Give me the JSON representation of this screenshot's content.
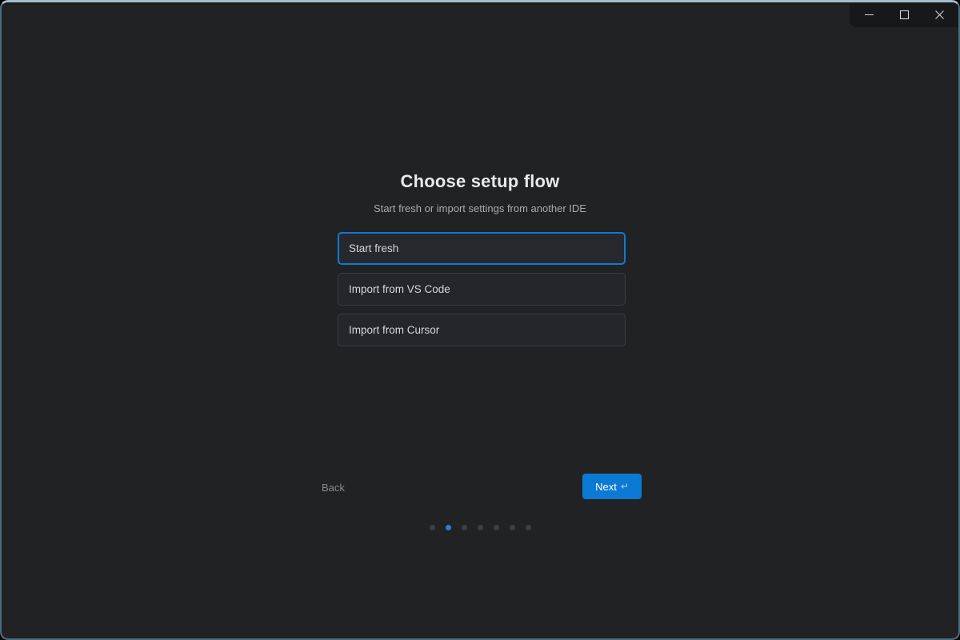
{
  "window": {
    "controls": [
      {
        "name": "minimize"
      },
      {
        "name": "maximize"
      },
      {
        "name": "close"
      }
    ]
  },
  "setup": {
    "title": "Choose setup flow",
    "subtitle": "Start fresh or import settings from another IDE",
    "options": [
      {
        "label": "Start fresh",
        "selected": true
      },
      {
        "label": "Import from VS Code",
        "selected": false
      },
      {
        "label": "Import from Cursor",
        "selected": false
      }
    ],
    "back_label": "Back",
    "next_label": "Next",
    "next_icon": "↵",
    "pagination": {
      "count": 7,
      "active_index": 1
    }
  },
  "colors": {
    "accent_blue": "#0f7ad6",
    "next_button_bg": "#0c7ad2",
    "active_dot": "#2e7ed8",
    "inactive_dot": "#3c3f43",
    "content_bg": "#212224",
    "titlebar_panel_bg": "#17181a",
    "window_border_top": "#a6bdca",
    "window_border_side": "#4b6d7c"
  }
}
